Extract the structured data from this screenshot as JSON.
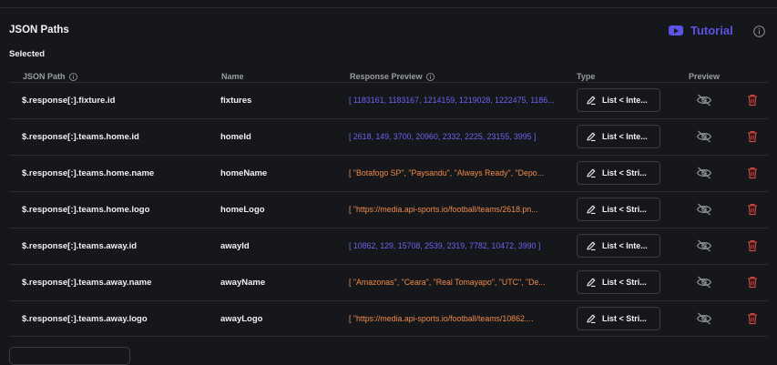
{
  "section_title": "JSON Paths",
  "selected_label": "Selected",
  "tutorial_label": "Tutorial",
  "colors": {
    "accent": "#5b52e8",
    "number_preview": "#6b63f0",
    "string_preview": "#f08a4b",
    "delete": "#e0463c"
  },
  "columns": {
    "json_path": "JSON Path",
    "name": "Name",
    "response_preview": "Response Preview",
    "type": "Type",
    "preview": "Preview"
  },
  "rows": [
    {
      "path": "$.response[:].fixture.id",
      "name": "fixtures",
      "preview": "[ 1183161, 1183167, 1214159, 1219028, 1222475, 1186...",
      "preview_kind": "num",
      "type": "List < Inte..."
    },
    {
      "path": "$.response[:].teams.home.id",
      "name": "homeId",
      "preview": "[ 2618, 149, 3700, 20960, 2332, 2225, 23155, 3995 ]",
      "preview_kind": "num",
      "type": "List < Inte..."
    },
    {
      "path": "$.response[:].teams.home.name",
      "name": "homeName",
      "preview": "[ \"Botafogo SP\", \"Paysandu\", \"Always Ready\", \"Depo...",
      "preview_kind": "str",
      "type": "List < Stri..."
    },
    {
      "path": "$.response[:].teams.home.logo",
      "name": "homeLogo",
      "preview": "[ \"https://media.api-sports.io/football/teams/2618.pn...",
      "preview_kind": "str",
      "type": "List < Stri..."
    },
    {
      "path": "$.response[:].teams.away.id",
      "name": "awayId",
      "preview": "[ 10862, 129, 15708, 2539, 2319, 7782, 10472, 3990 ]",
      "preview_kind": "num",
      "type": "List < Inte..."
    },
    {
      "path": "$.response[:].teams.away.name",
      "name": "awayName",
      "preview": "[ \"Amazonas\", \"Ceara\", \"Real Tomayapo\", \"UTC\", \"De...",
      "preview_kind": "str",
      "type": "List < Stri..."
    },
    {
      "path": "$.response[:].teams.away.logo",
      "name": "awayLogo",
      "preview": "[ \"https://media.api-sports.io/football/teams/10862....",
      "preview_kind": "str",
      "type": "List < Stri..."
    }
  ]
}
